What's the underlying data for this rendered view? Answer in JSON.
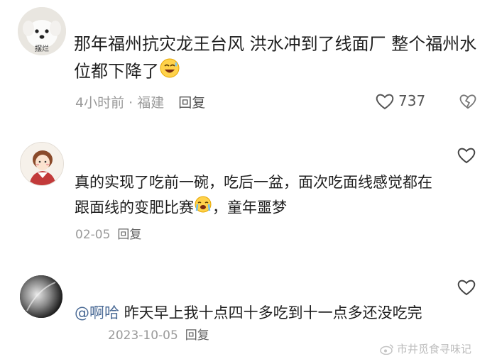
{
  "comments": [
    {
      "text": "那年福州抗灾龙王台风 洪水冲到了线面厂 整个福州水位都下降了",
      "time": "4小时前",
      "location": "福建",
      "reply_label": "回复",
      "likes": "737",
      "avatar_text": "摆烂"
    },
    {
      "text_part1": "真的实现了吃前一碗，吃后一盆，面次吃面线感觉都在跟面线的变肥比赛",
      "text_part2": "，童年噩梦",
      "date": "02-05",
      "reply_label": "回复"
    },
    {
      "mention": "@啊哈",
      "text": " 昨天早上我十点四十多吃到十一点多还没吃完",
      "date": "2023-10-05",
      "reply_label": "回复"
    }
  ],
  "watermark": {
    "text": "市井觅食寻味记"
  },
  "icons": {
    "like": "heart-outline-icon",
    "dislike": "broken-heart-icon",
    "emoji1": "laughing-sweat-emoji",
    "emoji2": "crying-emoji",
    "watermark": "weibo-icon"
  },
  "colors": {
    "meta": "#9a9a9a",
    "mention": "#4a6a95",
    "text": "#1f1f1f"
  }
}
